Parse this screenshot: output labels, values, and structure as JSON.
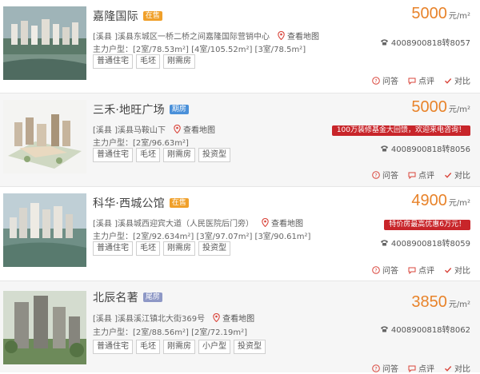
{
  "listings": [
    {
      "title": "嘉隆国际",
      "badge": "在售",
      "badge_color": "#f0a02a",
      "address": "[溪县 ]溪县东城区一桥二桥之间嘉隆国际营销中心",
      "map_label": "查看地图",
      "units": "主力户型：[2室/78.53m²]  [4室/105.52m²]  [3室/78.5m²]",
      "tags": [
        "普通住宅",
        "毛坯",
        "刚需房"
      ],
      "price": "5000",
      "price_unit": "元/m²",
      "promo": "",
      "phone": "4008900818转8057",
      "actions": {
        "ask": "问答",
        "review": "点评",
        "compare": "对比"
      }
    },
    {
      "title": "三禾·地旺广场",
      "badge": "期房",
      "badge_color": "#4a90d9",
      "address": "[溪县 ]溪县马鞍山下",
      "map_label": "查看地图",
      "units": "主力户型：[2室/96.63m²]",
      "tags": [
        "普通住宅",
        "毛坯",
        "刚需房",
        "投资型"
      ],
      "price": "5000",
      "price_unit": "元/m²",
      "promo": "100万装修基金大回馈，欢迎来电咨询！",
      "phone": "4008900818转8056",
      "actions": {
        "ask": "问答",
        "review": "点评",
        "compare": "对比"
      }
    },
    {
      "title": "科华·西城公馆",
      "badge": "在售",
      "badge_color": "#f0a02a",
      "address": "[溪县 ]溪县城西迎宾大道（人民医院后门旁）",
      "map_label": "查看地图",
      "units": "主力户型：[2室/92.634m²]  [3室/97.07m²]  [3室/90.61m²]",
      "tags": [
        "普通住宅",
        "毛坯",
        "刚需房",
        "投资型"
      ],
      "price": "4900",
      "price_unit": "元/m²",
      "promo": "特价房最高优惠6万元！",
      "phone": "4008900818转8059",
      "actions": {
        "ask": "问答",
        "review": "点评",
        "compare": "对比"
      }
    },
    {
      "title": "北辰名著",
      "badge": "尾房",
      "badge_color": "#8e98c6",
      "address": "[溪县 ]溪县溪江镇北大街369号",
      "map_label": "查看地图",
      "units": "主力户型：[2室/88.56m²]  [2室/72.19m²]",
      "tags": [
        "普通住宅",
        "毛坯",
        "刚需房",
        "小户型",
        "投资型"
      ],
      "price": "3850",
      "price_unit": "元/m²",
      "promo": "",
      "phone": "4008900818转8062",
      "actions": {
        "ask": "问答",
        "review": "点评",
        "compare": "对比"
      }
    }
  ]
}
